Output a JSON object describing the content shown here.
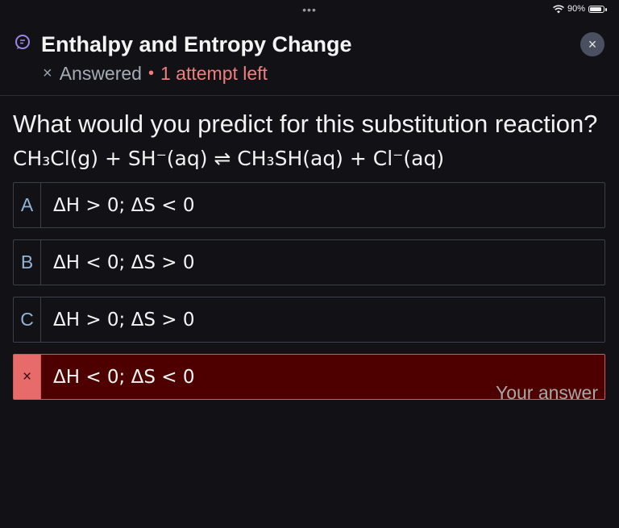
{
  "status_bar": {
    "dots": "•••",
    "battery": "90%"
  },
  "header": {
    "title": "Enthalpy and Entropy Change",
    "status_icon": "×",
    "status": "Answered",
    "separator": "•",
    "attempts": "1 attempt left",
    "close_icon": "×"
  },
  "question": {
    "text": "What would you predict for this substitution reaction?",
    "equation": "CH₃Cl(g) + SH⁻(aq) ⇌ CH₃SH(aq) + Cl⁻(aq)"
  },
  "options": [
    {
      "letter": "A",
      "text": "ΔH > 0; ΔS < 0"
    },
    {
      "letter": "B",
      "text": "ΔH < 0; ΔS > 0"
    },
    {
      "letter": "C",
      "text": "ΔH > 0; ΔS > 0"
    },
    {
      "letter": "×",
      "text": "ΔH < 0; ΔS < 0",
      "note": "Your answer"
    }
  ],
  "colors": {
    "background": "#121216",
    "selected_bg": "#4e0000",
    "selected_marker": "#e86b6b",
    "attempts_text": "#f07e7e",
    "letter_text": "#8fb4d8"
  }
}
